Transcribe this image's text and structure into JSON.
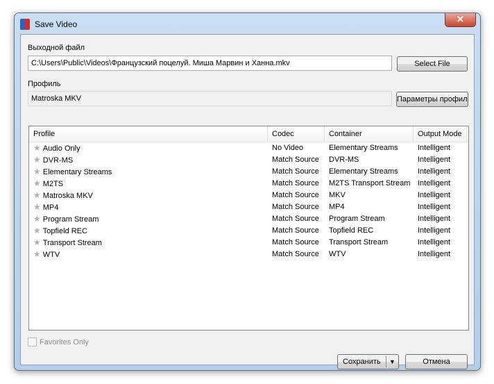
{
  "window": {
    "title": "Save Video",
    "close": "✕"
  },
  "output": {
    "label": "Выходной файл",
    "value": "C:\\Users\\Public\\Videos\\Французский поцелуй. Миша Марвин и Ханна.mkv",
    "select_button": "Select File"
  },
  "profile": {
    "label": "Профиль",
    "value": "Matroska MKV",
    "params_button": "Параметры профиля"
  },
  "table": {
    "headers": [
      "Profile",
      "Codec",
      "Container",
      "Output Mode"
    ],
    "rows": [
      [
        "Audio Only",
        "No Video",
        "Elementary Streams",
        "Intelligent"
      ],
      [
        "DVR-MS",
        "Match Source",
        "DVR-MS",
        "Intelligent"
      ],
      [
        "Elementary Streams",
        "Match Source",
        "Elementary Streams",
        "Intelligent"
      ],
      [
        "M2TS",
        "Match Source",
        "M2TS Transport Stream",
        "Intelligent"
      ],
      [
        "Matroska MKV",
        "Match Source",
        "MKV",
        "Intelligent"
      ],
      [
        "MP4",
        "Match Source",
        "MP4",
        "Intelligent"
      ],
      [
        "Program Stream",
        "Match Source",
        "Program Stream",
        "Intelligent"
      ],
      [
        "Topfield REC",
        "Match Source",
        "Topfield REC",
        "Intelligent"
      ],
      [
        "Transport Stream",
        "Match Source",
        "Transport Stream",
        "Intelligent"
      ],
      [
        "WTV",
        "Match Source",
        "WTV",
        "Intelligent"
      ]
    ]
  },
  "favorites": {
    "label": "Favorites Only",
    "checked": false
  },
  "buttons": {
    "save": "Сохранить",
    "cancel": "Отмена"
  }
}
